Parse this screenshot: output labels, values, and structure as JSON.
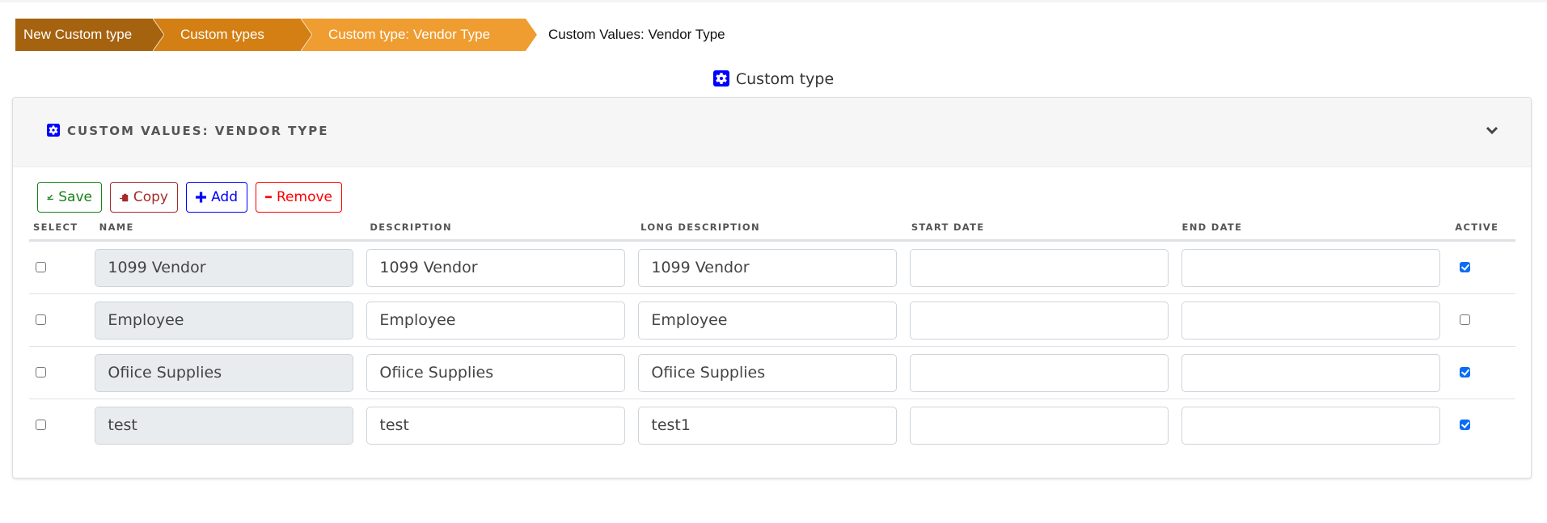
{
  "breadcrumb": [
    {
      "label": "New Custom type",
      "color": "#a5620f"
    },
    {
      "label": "Custom types",
      "color": "#d37f13"
    },
    {
      "label": "Custom type: Vendor Type",
      "color": "#ef9c30"
    },
    {
      "label": "Custom Values: Vendor Type"
    }
  ],
  "page_title": {
    "icon": "gear-icon",
    "label": "Custom type"
  },
  "card": {
    "title": "Custom Values: Vendor Type",
    "icon": "gear-icon",
    "collapse_icon": "chevron-down-icon"
  },
  "toolbar": {
    "save_label": "Save",
    "copy_label": "Copy",
    "add_label": "Add",
    "remove_label": "Remove"
  },
  "table": {
    "columns": [
      "Select",
      "Name",
      "Description",
      "Long Description",
      "Start Date",
      "End Date",
      "Active"
    ],
    "rows": [
      {
        "selected": false,
        "name": "1099 Vendor",
        "description": "1099 Vendor",
        "long_description": "1099 Vendor",
        "start_date": "",
        "end_date": "",
        "active": true
      },
      {
        "selected": false,
        "name": "Employee",
        "description": "Employee",
        "long_description": "Employee",
        "start_date": "",
        "end_date": "",
        "active": false
      },
      {
        "selected": false,
        "name": "Ofiice Supplies",
        "description": "Ofiice Supplies",
        "long_description": "Ofiice Supplies",
        "start_date": "",
        "end_date": "",
        "active": true
      },
      {
        "selected": false,
        "name": "test",
        "description": "test",
        "long_description": "test1",
        "start_date": "",
        "end_date": "",
        "active": true
      }
    ]
  },
  "colors": {
    "save": "#198019",
    "copy": "#a52a2a",
    "add": "#0000ff",
    "remove": "#ff0000",
    "icon_blue": "#0000ff",
    "checkbox_checked": "#0b6cf5"
  }
}
